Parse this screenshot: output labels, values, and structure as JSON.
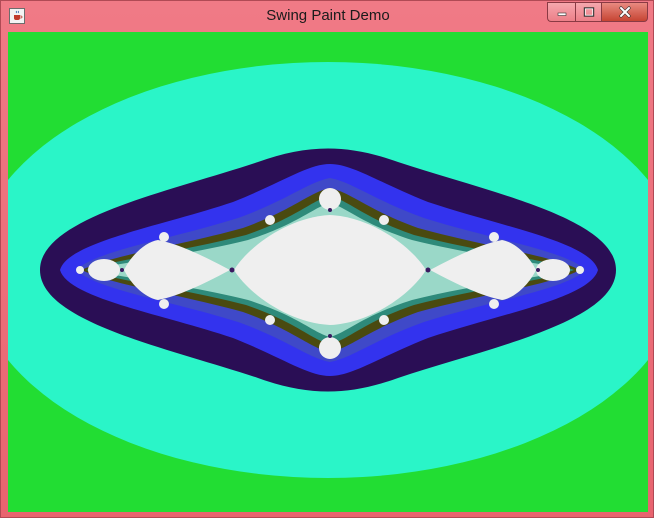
{
  "window": {
    "title": "Swing Paint Demo",
    "icon": "java-cup-icon",
    "controls": [
      "minimize-icon",
      "maximize-icon",
      "close-icon"
    ]
  },
  "canvas": {
    "content": "julia-set-fractal",
    "colors": {
      "outer": "#22dd33",
      "ring1": "#2af5c8",
      "ring2": "#2a0e55",
      "ring3": "#3333ee",
      "band_blue": "#3f49c8",
      "band_olive": "#4a4a10",
      "band_teal": "#2e8a7a",
      "band_light": "#9ad8c8",
      "interior": "#efefef"
    }
  }
}
